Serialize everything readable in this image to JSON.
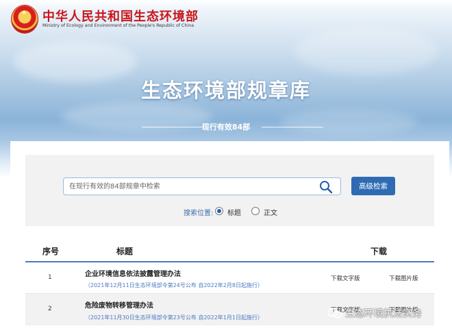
{
  "header": {
    "org_cn": "中华人民共和国生态环境部",
    "org_en": "Ministry of Ecology and Environment of the People's Republic of China"
  },
  "site": {
    "title": "生态环境部规章库",
    "count_text": "现行有效84部"
  },
  "search": {
    "placeholder": "在现行有效的84部规章中检索",
    "value": "",
    "advanced_label": "高级检索",
    "position_label": "搜索位置:",
    "options": [
      {
        "label": "标题",
        "selected": true
      },
      {
        "label": "正文",
        "selected": false
      }
    ]
  },
  "table": {
    "headers": {
      "no": "序号",
      "title": "标题",
      "download": "下载"
    },
    "rows": [
      {
        "no": "1",
        "title": "企业环境信息依法披露管理办法",
        "subtitle": "（2021年12月11日生态环境部令第24号公布  自2022年2月8日起施行）",
        "download_text": "下载文字版",
        "download_image": "下载图片版"
      },
      {
        "no": "2",
        "title": "危险废物转移管理办法",
        "subtitle": "（2021年11月30日生态环境部令第23号公布  自2022年1月1日起施行）",
        "download_text": "下载文字版",
        "download_image": "下载图片版"
      }
    ]
  },
  "watermark": {
    "text": "生态环境执法实务",
    "icon": "wechat-icon"
  },
  "colors": {
    "brand_red": "#c9161b",
    "accent_blue": "#2e6bb3",
    "link_blue": "#4a7ac0"
  }
}
